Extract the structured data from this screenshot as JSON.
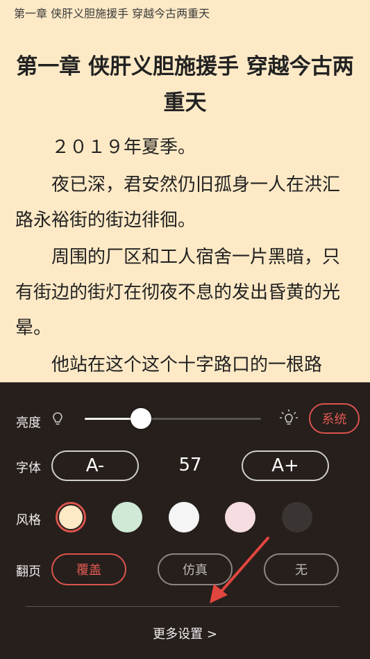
{
  "reader": {
    "running_header": "第一章 侠肝义胆施援手 穿越今古两重天",
    "chapter_title": "第一章 侠肝义胆施援手 穿越今古两重天",
    "paragraphs": [
      "２０１９年夏季。",
      "夜已深，君安然仍旧孤身一人在洪汇路永裕街的街边徘徊。",
      "周围的厂区和工人宿舍一片黑暗，只有街边的街灯在彻夜不息的发出昏黄的光晕。",
      "他站在这个这个十字路口的一根路"
    ],
    "background_color": "#fde9c6"
  },
  "settings": {
    "brightness": {
      "label": "亮度",
      "value": 0.32,
      "system_button": "系统",
      "icons": [
        "bulb-off-icon",
        "bulb-on-icon"
      ]
    },
    "font": {
      "label": "字体",
      "decrease": "A-",
      "size": "57",
      "increase": "A+"
    },
    "style": {
      "label": "风格",
      "swatches": [
        "#fde9c6",
        "#cfe9d6",
        "#f5f5f5",
        "#f5dde2",
        "#3a3432"
      ],
      "selected_index": 0
    },
    "page_turn": {
      "label": "翻页",
      "options": [
        "覆盖",
        "仿真",
        "无"
      ],
      "selected_index": 0
    },
    "more": "更多设置 >",
    "accent_color": "#e05a52",
    "panel_color": "#261f1c"
  }
}
